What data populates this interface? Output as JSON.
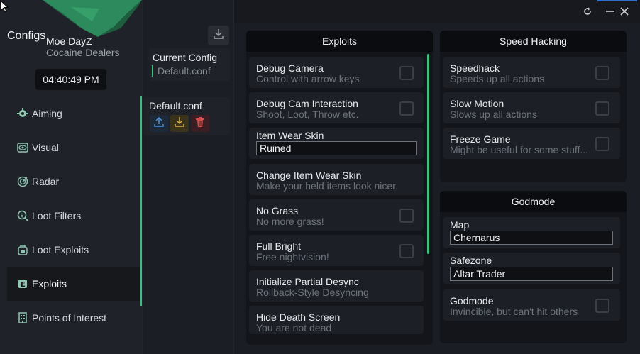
{
  "user": {
    "name": "Moe DayZ",
    "subtitle": "Cocaine Dealers",
    "clock": "04:40:49 PM"
  },
  "nav": [
    {
      "label": "Aiming",
      "icon": "crosshair-target-icon",
      "active": false
    },
    {
      "label": "Visual",
      "icon": "eye-icon",
      "active": false
    },
    {
      "label": "Radar",
      "icon": "radar-icon",
      "active": false
    },
    {
      "label": "Loot Filters",
      "icon": "money-filter-icon",
      "active": false
    },
    {
      "label": "Loot Exploits",
      "icon": "backpack-icon",
      "active": false
    },
    {
      "label": "Exploits",
      "icon": "exploit-badge-icon",
      "active": true
    },
    {
      "label": "Points of Interest",
      "icon": "building-icon",
      "active": false
    }
  ],
  "configs": {
    "title": "Configs",
    "current_label": "Current Config",
    "current_value": "Default.conf",
    "files": [
      {
        "name": "Default.conf"
      }
    ]
  },
  "exploits": {
    "title": "Exploits",
    "items": [
      {
        "title": "Debug Camera",
        "subtitle": "Control with arrow keys",
        "checked": false
      },
      {
        "title": "Debug Cam Interaction",
        "subtitle": "Shoot, Loot, Throw etc.",
        "checked": false
      },
      {
        "title": "Item Wear Skin",
        "value": "Ruined"
      },
      {
        "title": "Change Item Wear Skin",
        "subtitle": "Make your held items look nicer."
      },
      {
        "title": "No Grass",
        "subtitle": "No more grass!",
        "checked": false
      },
      {
        "title": "Full Bright",
        "subtitle": "Free nightvision!",
        "checked": false
      },
      {
        "title": "Initialize Partial Desync",
        "subtitle": "Rollback-Style Desyncing"
      },
      {
        "title": "Hide Death Screen",
        "subtitle": "You are not dead"
      }
    ]
  },
  "speed": {
    "title": "Speed Hacking",
    "items": [
      {
        "title": "Speedhack",
        "subtitle": "Speeds up all actions",
        "checked": false
      },
      {
        "title": "Slow Motion",
        "subtitle": "Slows up all actions",
        "checked": false
      },
      {
        "title": "Freeze Game",
        "subtitle": "Might be useful for some stuff...",
        "checked": false
      }
    ]
  },
  "godmode": {
    "title": "Godmode",
    "map_label": "Map",
    "map_value": "Chernarus",
    "safezone_label": "Safezone",
    "safezone_value": "Altar Trader",
    "toggle_title": "Godmode",
    "toggle_subtitle": "Invincible, but can't hit others",
    "checked": false
  },
  "colors": {
    "accent": "#3fbf7f",
    "panel": "#13151a",
    "row": "#1c1f25"
  }
}
